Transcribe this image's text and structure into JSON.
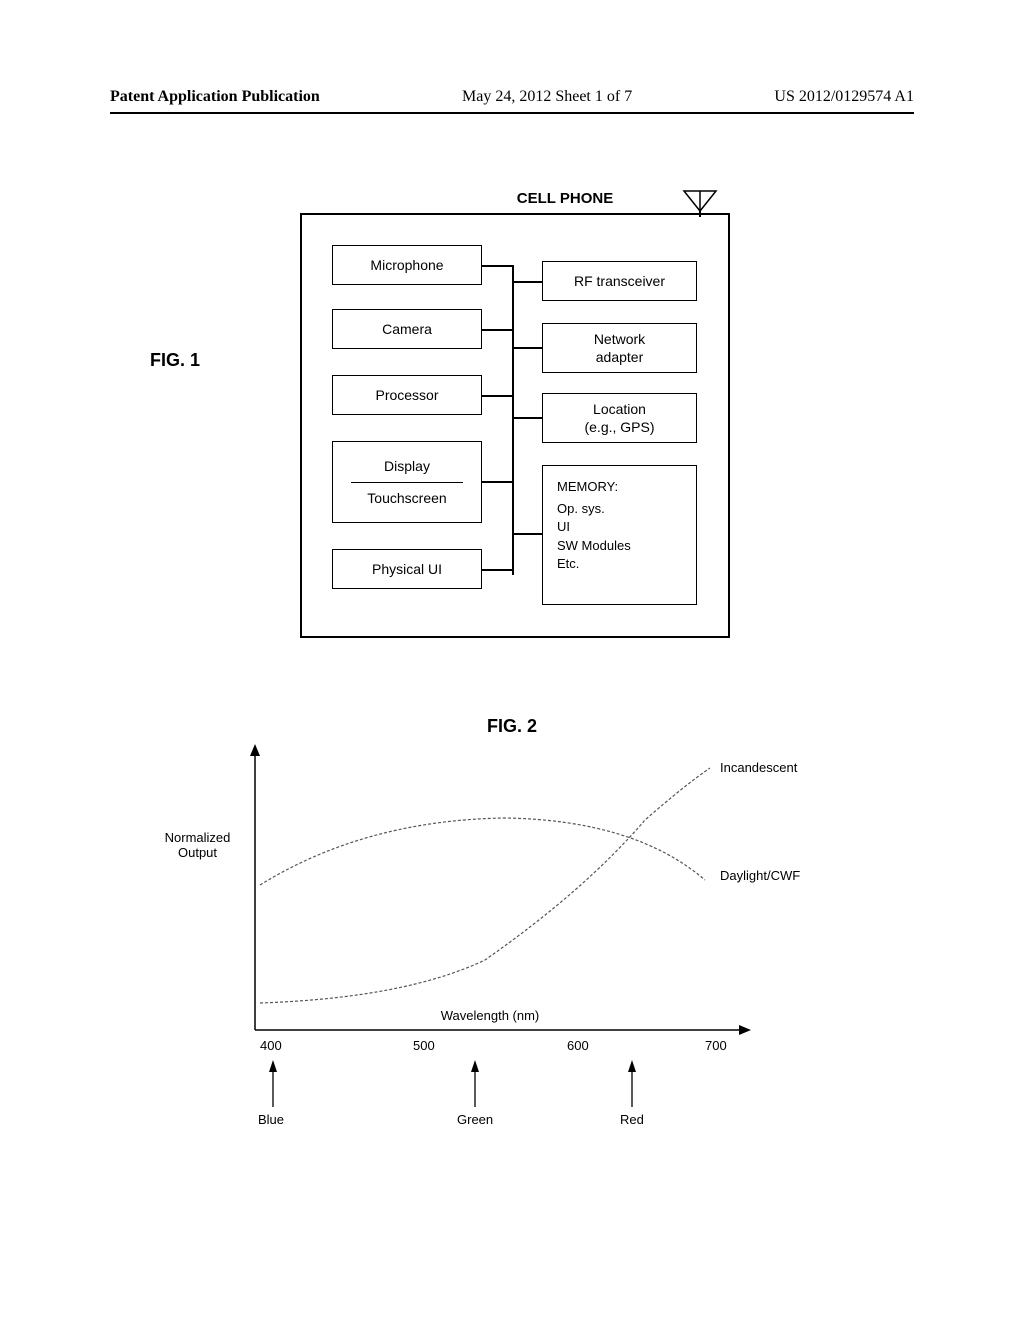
{
  "header": {
    "left": "Patent Application Publication",
    "center": "May 24, 2012  Sheet 1 of 7",
    "right": "US 2012/0129574 A1"
  },
  "fig1": {
    "label": "FIG. 1",
    "title": "CELL PHONE",
    "blocks": {
      "microphone": "Microphone",
      "camera": "Camera",
      "processor": "Processor",
      "display": "Display",
      "touchscreen": "Touchscreen",
      "physical_ui": "Physical UI",
      "rf_transceiver": "RF transceiver",
      "network_adapter": "Network\nadapter",
      "location": "Location\n(e.g., GPS)",
      "memory_title": "MEMORY:",
      "memory_lines": [
        "Op. sys.",
        "UI",
        "SW Modules",
        "Etc."
      ]
    }
  },
  "fig2": {
    "label": "FIG. 2",
    "ylabel_line1": "Normalized",
    "ylabel_line2": "Output",
    "xlabel": "Wavelength (nm)",
    "ticks": [
      "400",
      "500",
      "600",
      "700"
    ],
    "series1": "Incandescent",
    "series2": "Daylight/CWF",
    "colors": {
      "blue": "Blue",
      "green": "Green",
      "red": "Red"
    }
  },
  "chart_data": {
    "type": "line",
    "title": "FIG. 2",
    "xlabel": "Wavelength (nm)",
    "ylabel": "Normalized Output",
    "xlim": [
      400,
      700
    ],
    "ylim": [
      0,
      1
    ],
    "x": [
      400,
      430,
      460,
      490,
      520,
      550,
      580,
      610,
      640,
      670,
      700
    ],
    "series": [
      {
        "name": "Incandescent",
        "values": [
          0.1,
          0.12,
          0.15,
          0.2,
          0.27,
          0.37,
          0.5,
          0.65,
          0.79,
          0.9,
          0.97
        ]
      },
      {
        "name": "Daylight/CWF",
        "values": [
          0.53,
          0.62,
          0.68,
          0.72,
          0.74,
          0.74,
          0.73,
          0.7,
          0.66,
          0.61,
          0.55
        ]
      }
    ],
    "annotations": [
      {
        "x": 400,
        "label": "Blue"
      },
      {
        "x": 540,
        "label": "Green"
      },
      {
        "x": 640,
        "label": "Red"
      }
    ]
  }
}
